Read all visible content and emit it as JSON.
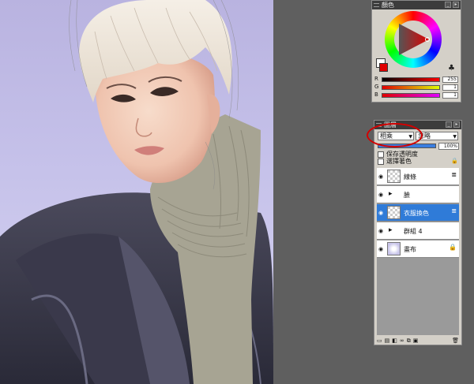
{
  "color_panel": {
    "title": "顏色",
    "rgb": [
      {
        "label": "R",
        "value": "255"
      },
      {
        "label": "G",
        "value": "1"
      },
      {
        "label": "B",
        "value": "1"
      }
    ],
    "foreground_color": "#ffffff",
    "background_color": "#e00000"
  },
  "layer_panel": {
    "title": "圖層",
    "blend_mode": "相乘",
    "opacity_mode": "忽略",
    "opacity_value": "100%",
    "opacity_level": 1.0,
    "preserve_transparency": "保存透明度",
    "select_color": "選擇著色",
    "layers": [
      {
        "name": "線條",
        "type": "layer",
        "selected": false
      },
      {
        "name": "臉",
        "type": "group",
        "selected": false
      },
      {
        "name": "衣服換色",
        "type": "layer",
        "selected": true
      },
      {
        "name": "群組 4",
        "type": "group",
        "selected": false
      },
      {
        "name": "畫布",
        "type": "canvas",
        "selected": false
      }
    ],
    "highlight_color": "#d40000"
  }
}
